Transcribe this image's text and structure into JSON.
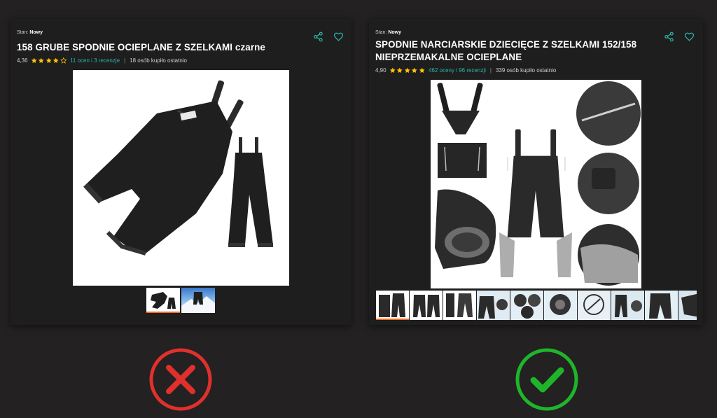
{
  "left_listing": {
    "condition_label": "Stan:",
    "condition_value": "Nowy",
    "title": "158 GRUBE SPODNIE OCIEPLANE Z SZELKAMI czarne",
    "rating": "4,36",
    "stars": 4.36,
    "reviews_link": "11 ocen i 3 recenzje",
    "separator": "|",
    "purchases": "18 osób kupiło ostatnio",
    "thumbnail_count": 2,
    "selected_thumbnail": 1,
    "icons": [
      "share-icon",
      "heart-icon"
    ]
  },
  "right_listing": {
    "condition_label": "Stan:",
    "condition_value": "Nowy",
    "title": "SPODNIE NARCIARSKIE DZIECIĘCE Z SZELKAMI 152/158 NIEPRZEMAKALNE OCIEPLANE",
    "rating": "4,90",
    "stars": 4.9,
    "reviews_link": "462 oceny i 96 recenzji",
    "separator": "|",
    "purchases": "339 osób kupiło ostatnio",
    "thumbnail_count": 10,
    "selected_thumbnail": 1,
    "icons": [
      "share-icon",
      "heart-icon"
    ]
  },
  "verdicts": {
    "left": "cross-icon",
    "right": "check-icon"
  },
  "colors": {
    "page_background": "#232121",
    "card_background": "#1e1e1e",
    "accent_teal": "#29b6a6",
    "star_yellow": "#ffc200",
    "selected_orange": "#f06a1d",
    "bad_red": "#e0302d",
    "good_green": "#1fb52a"
  }
}
